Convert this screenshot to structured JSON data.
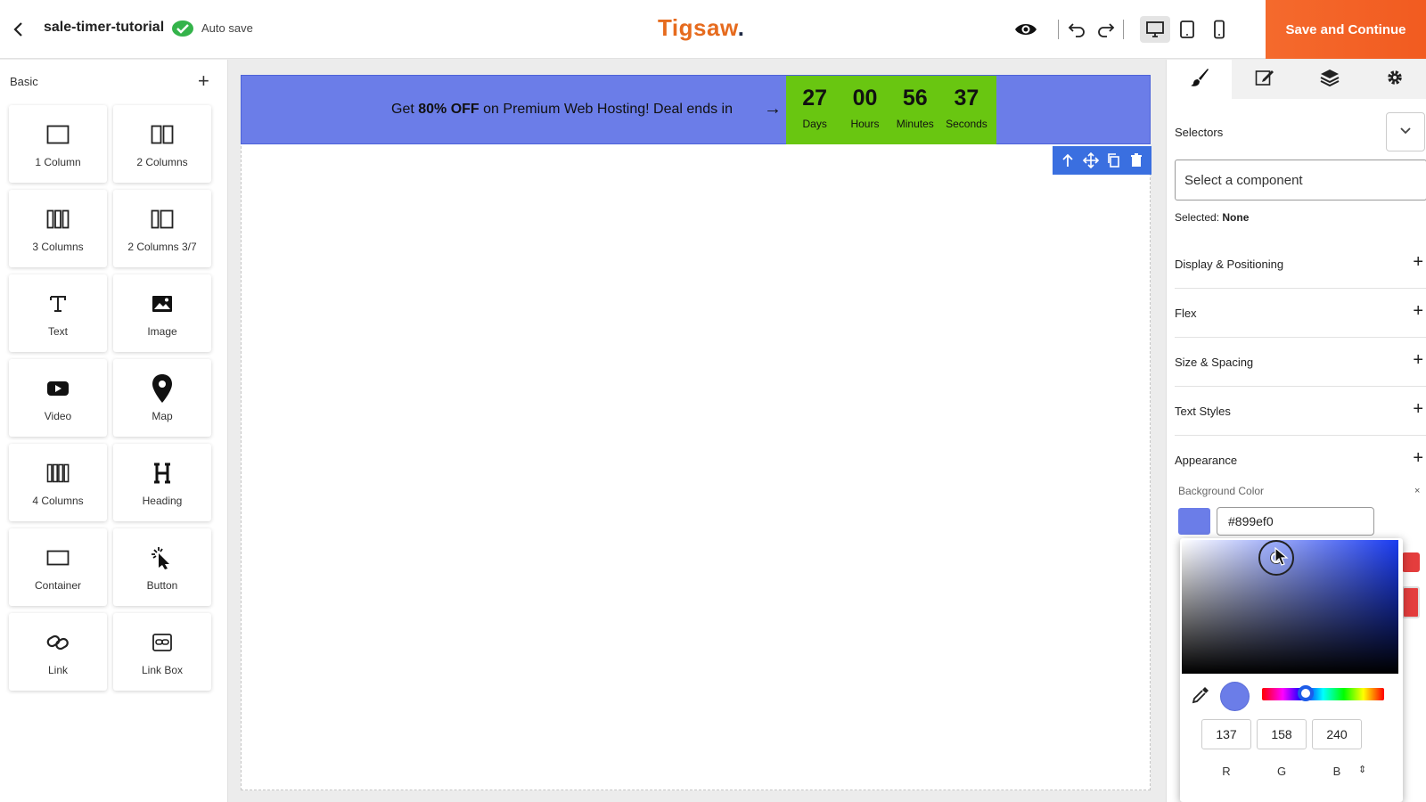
{
  "header": {
    "project_name": "sale-timer-tutorial",
    "autosave_label": "Auto save",
    "brand": "Tigsaw",
    "brand_dot": ".",
    "save_button": "Save and Continue"
  },
  "blocks_panel": {
    "title": "Basic",
    "blocks": [
      {
        "label": "1 Column",
        "icon": "one-column-icon"
      },
      {
        "label": "2 Columns",
        "icon": "two-columns-icon"
      },
      {
        "label": "3 Columns",
        "icon": "three-columns-icon"
      },
      {
        "label": "2 Columns 3/7",
        "icon": "two-columns-37-icon"
      },
      {
        "label": "Text",
        "icon": "text-icon"
      },
      {
        "label": "Image",
        "icon": "image-icon"
      },
      {
        "label": "Video",
        "icon": "video-icon"
      },
      {
        "label": "Map",
        "icon": "map-pin-icon"
      },
      {
        "label": "4 Columns",
        "icon": "four-columns-icon"
      },
      {
        "label": "Heading",
        "icon": "heading-icon"
      },
      {
        "label": "Container",
        "icon": "container-icon"
      },
      {
        "label": "Button",
        "icon": "button-click-icon"
      },
      {
        "label": "Link",
        "icon": "link-icon"
      },
      {
        "label": "Link Box",
        "icon": "link-box-icon"
      }
    ]
  },
  "banner": {
    "text_pre": "Get ",
    "text_bold": "80% OFF",
    "text_post": " on Premium Web Hosting! Deal ends in",
    "arrow": "→",
    "background_color": "#6b7de8",
    "timer_color": "#69c611",
    "timer": [
      {
        "value": "27",
        "label": "Days"
      },
      {
        "value": "00",
        "label": "Hours"
      },
      {
        "value": "56",
        "label": "Minutes"
      },
      {
        "value": "37",
        "label": "Seconds"
      }
    ]
  },
  "style_panel": {
    "selectors_label": "Selectors",
    "selector_placeholder": "Select a component",
    "selected_prefix": "Selected: ",
    "selected_value": "None",
    "sections": [
      {
        "label": "Display & Positioning"
      },
      {
        "label": "Flex"
      },
      {
        "label": "Size & Spacing"
      },
      {
        "label": "Text Styles"
      },
      {
        "label": "Appearance"
      }
    ],
    "background_color_label": "Background Color",
    "close_symbol": "×",
    "hex_value": "#899ef0",
    "picker": {
      "r": "137",
      "g": "158",
      "b": "240",
      "r_label": "R",
      "g_label": "G",
      "b_label": "B",
      "mode_toggle": "⇕"
    }
  }
}
